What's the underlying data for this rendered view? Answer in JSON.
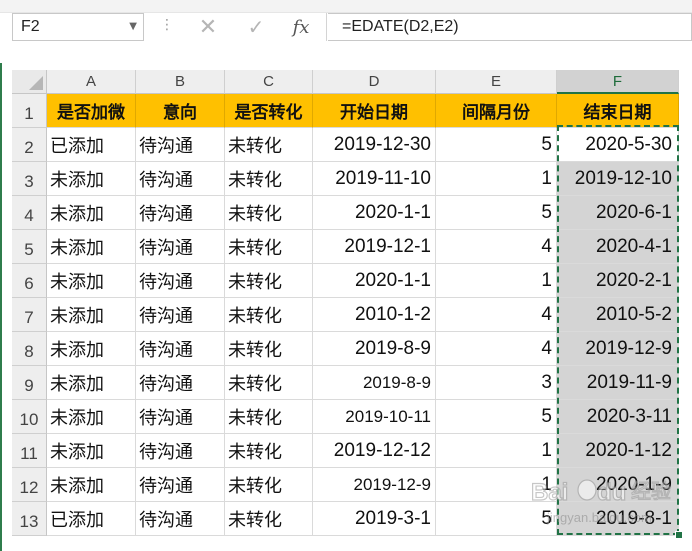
{
  "name_box": {
    "value": "F2"
  },
  "formula_bar": {
    "cancel_glyph": "✕",
    "enter_glyph": "✓",
    "fx_label": "fx",
    "formula": "=EDATE(D2,E2)"
  },
  "columns": [
    "A",
    "B",
    "C",
    "D",
    "E",
    "F"
  ],
  "selected_column": "F",
  "rows": [
    "1",
    "2",
    "3",
    "4",
    "5",
    "6",
    "7",
    "8",
    "9",
    "10",
    "11",
    "12",
    "13"
  ],
  "headers": [
    "是否加微",
    "意向",
    "是否转化",
    "开始日期",
    "间隔月份",
    "结束日期"
  ],
  "data": [
    [
      "已添加",
      "待沟通",
      "未转化",
      "2019-12-30",
      "5",
      "2020-5-30"
    ],
    [
      "未添加",
      "待沟通",
      "未转化",
      "2019-11-10",
      "1",
      "2019-12-10"
    ],
    [
      "未添加",
      "待沟通",
      "未转化",
      "2020-1-1",
      "5",
      "2020-6-1"
    ],
    [
      "未添加",
      "待沟通",
      "未转化",
      "2019-12-1",
      "4",
      "2020-4-1"
    ],
    [
      "未添加",
      "待沟通",
      "未转化",
      "2020-1-1",
      "1",
      "2020-2-1"
    ],
    [
      "未添加",
      "待沟通",
      "未转化",
      "2010-1-2",
      "4",
      "2010-5-2"
    ],
    [
      "未添加",
      "待沟通",
      "未转化",
      "2019-8-9",
      "4",
      "2019-12-9"
    ],
    [
      "未添加",
      "待沟通",
      "未转化",
      "2019-8-9",
      "3",
      "2019-11-9"
    ],
    [
      "未添加",
      "待沟通",
      "未转化",
      "2019-10-11",
      "5",
      "2020-3-11"
    ],
    [
      "未添加",
      "待沟通",
      "未转化",
      "2019-12-12",
      "1",
      "2020-1-12"
    ],
    [
      "未添加",
      "待沟通",
      "未转化",
      "2019-12-9",
      "1",
      "2020-1-9"
    ],
    [
      "已添加",
      "待沟通",
      "未转化",
      "2019-3-1",
      "5",
      "2019-8-1"
    ]
  ],
  "colors": {
    "header_fill": "#ffc000",
    "selection_fill": "#d4d4d4",
    "excel_green": "#217346"
  },
  "watermark": {
    "brand": "Baidu",
    "cn": "经验",
    "url": "jingyan.baidu.com"
  }
}
